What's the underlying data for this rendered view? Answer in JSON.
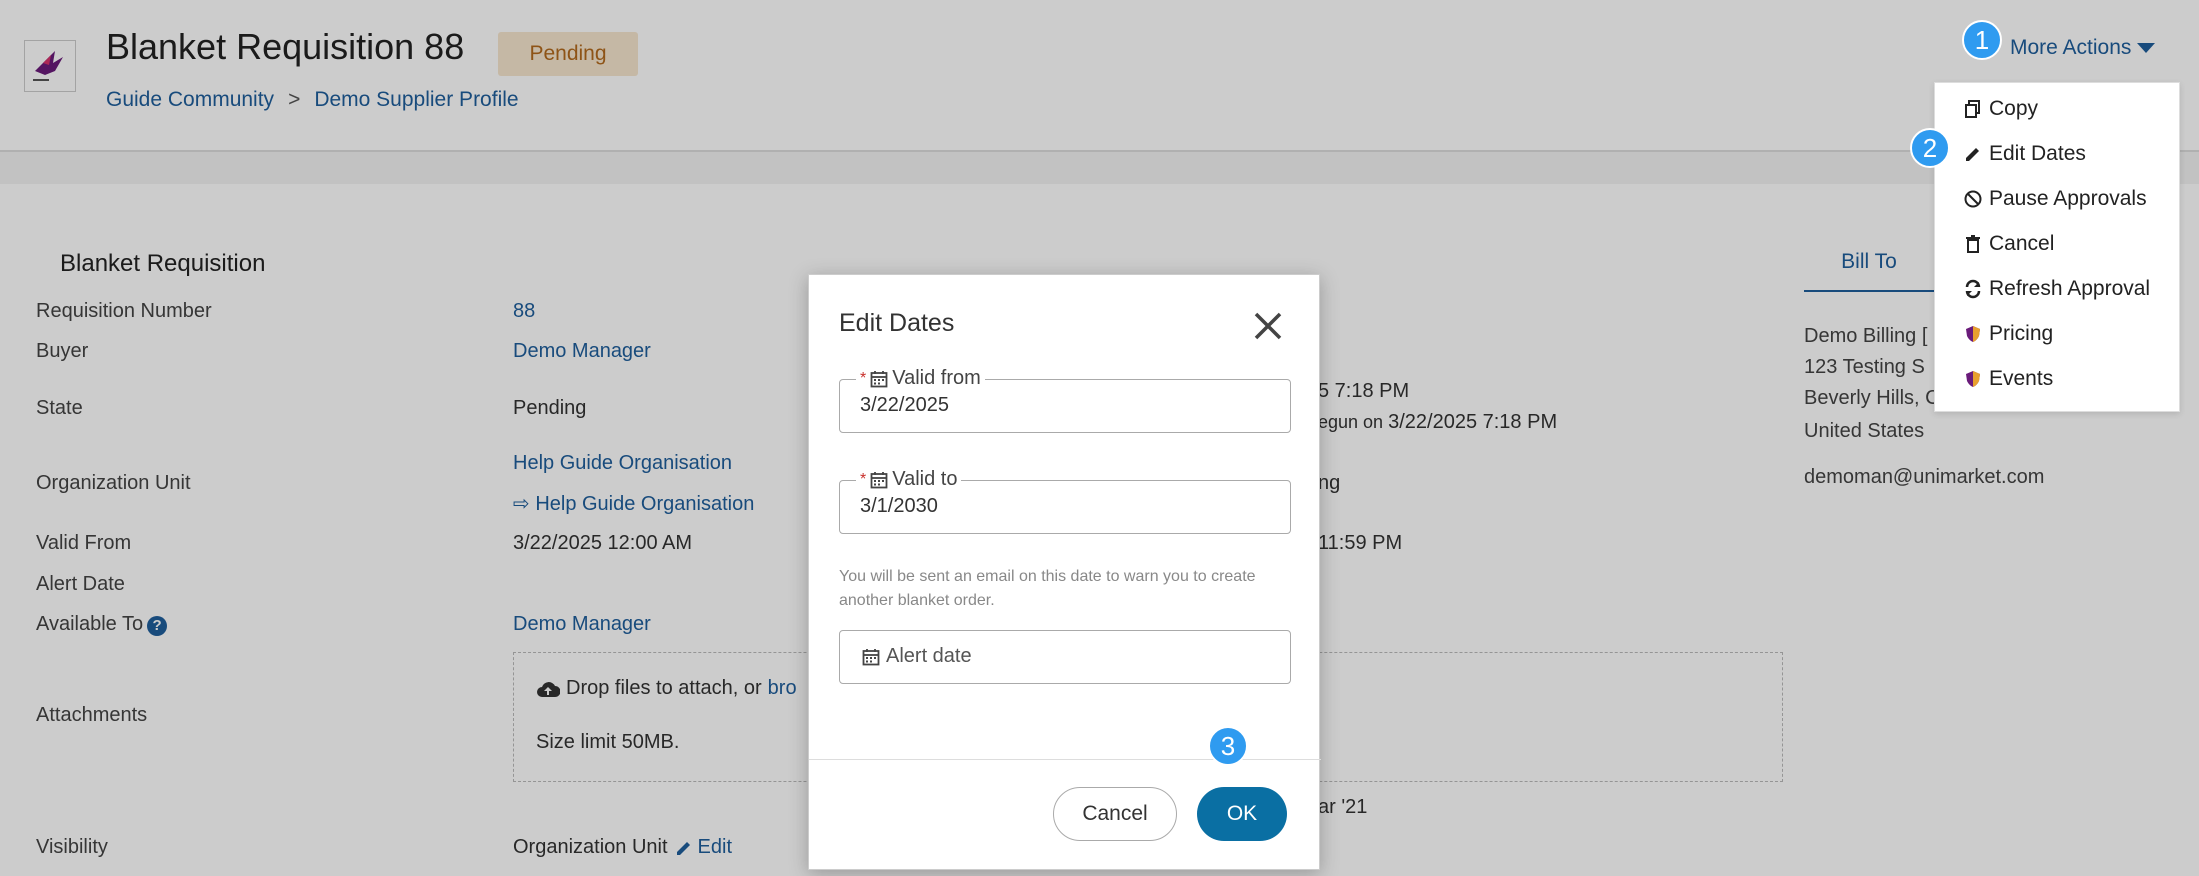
{
  "header": {
    "title": "Blanket Requisition 88",
    "status_badge": "Pending",
    "breadcrumb": [
      "Guide Community",
      "Demo Supplier Profile"
    ],
    "breadcrumb_sep": ">",
    "more_actions_label": "More Actions"
  },
  "steps": [
    "1",
    "2",
    "3"
  ],
  "menu": {
    "items": [
      {
        "label": "Copy",
        "icon": "copy-icon"
      },
      {
        "label": "Edit Dates",
        "icon": "pencil-icon"
      },
      {
        "label": "Pause Approvals",
        "icon": "ban-icon"
      },
      {
        "label": "Cancel",
        "icon": "trash-icon"
      },
      {
        "label": "Refresh Approval",
        "icon": "refresh-icon"
      },
      {
        "label": "Pricing",
        "icon": "shield-icon"
      },
      {
        "label": "Events",
        "icon": "shield-icon"
      }
    ]
  },
  "details": {
    "section_title": "Blanket Requisition",
    "requisition_number_label": "Requisition Number",
    "requisition_number": "88",
    "buyer_label": "Buyer",
    "buyer": "Demo Manager",
    "state_label": "State",
    "state": "Pending",
    "org_unit_label": "Organization Unit",
    "org_unit": "Help Guide Organisation",
    "org_unit_child": "⇨ Help Guide Organisation",
    "valid_from_label": "Valid From",
    "valid_from": "3/22/2025 12:00 AM",
    "alert_date_label": "Alert Date",
    "available_to_label": "Available To",
    "available_to": "Demo Manager",
    "attachments_label": "Attachments",
    "drop_text": "Drop files to attach, or",
    "drop_link": "bro",
    "size_limit": "Size limit 50MB.",
    "visibility_label": "Visibility",
    "visibility": "Organization Unit",
    "visibility_edit": "Edit"
  },
  "behind_modal": {
    "time1": "5 7:18 PM",
    "begun_prefix": "egun on",
    "begun_date": "3/22/2025 7:18 PM",
    "org_link_partial": "ng",
    "valid_to_partial": "11:59 PM",
    "date_partial": "ar '21"
  },
  "bill_to": {
    "tab_label": "Bill To",
    "lines": [
      "Demo Billing [",
      "123 Testing S",
      "Beverly Hills, C",
      "United States"
    ],
    "email": "demoman@unimarket.com"
  },
  "modal": {
    "title": "Edit Dates",
    "valid_from_label": "Valid from",
    "valid_from_value": "3/22/2025",
    "valid_to_label": "Valid to",
    "valid_to_value": "3/1/2030",
    "required_mark": "*",
    "hint": "You will be sent an email on this date to warn you to create another blanket order.",
    "alert_placeholder": "Alert date",
    "cancel_label": "Cancel",
    "ok_label": "OK"
  },
  "colors": {
    "link": "#1f5e9c",
    "badge_bg": "#f7e6cf",
    "badge_text": "#b26a1d",
    "step_bubble": "#2f9bf0",
    "ok_button": "#0a6fa3"
  }
}
